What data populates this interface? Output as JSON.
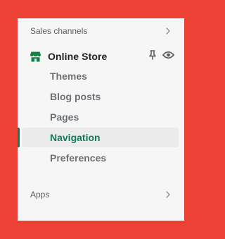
{
  "sales_channels": {
    "label": "Sales channels"
  },
  "online_store": {
    "label": "Online Store",
    "items": [
      {
        "label": "Themes"
      },
      {
        "label": "Blog posts"
      },
      {
        "label": "Pages"
      },
      {
        "label": "Navigation",
        "active": true
      },
      {
        "label": "Preferences"
      }
    ]
  },
  "apps": {
    "label": "Apps"
  },
  "colors": {
    "accent": "#107b5c",
    "store_icon": "#108043",
    "background": "#ee4135",
    "panel": "#f6f6f7"
  },
  "icons": [
    "chevron-right-icon",
    "store-icon",
    "pin-icon",
    "eye-icon"
  ]
}
